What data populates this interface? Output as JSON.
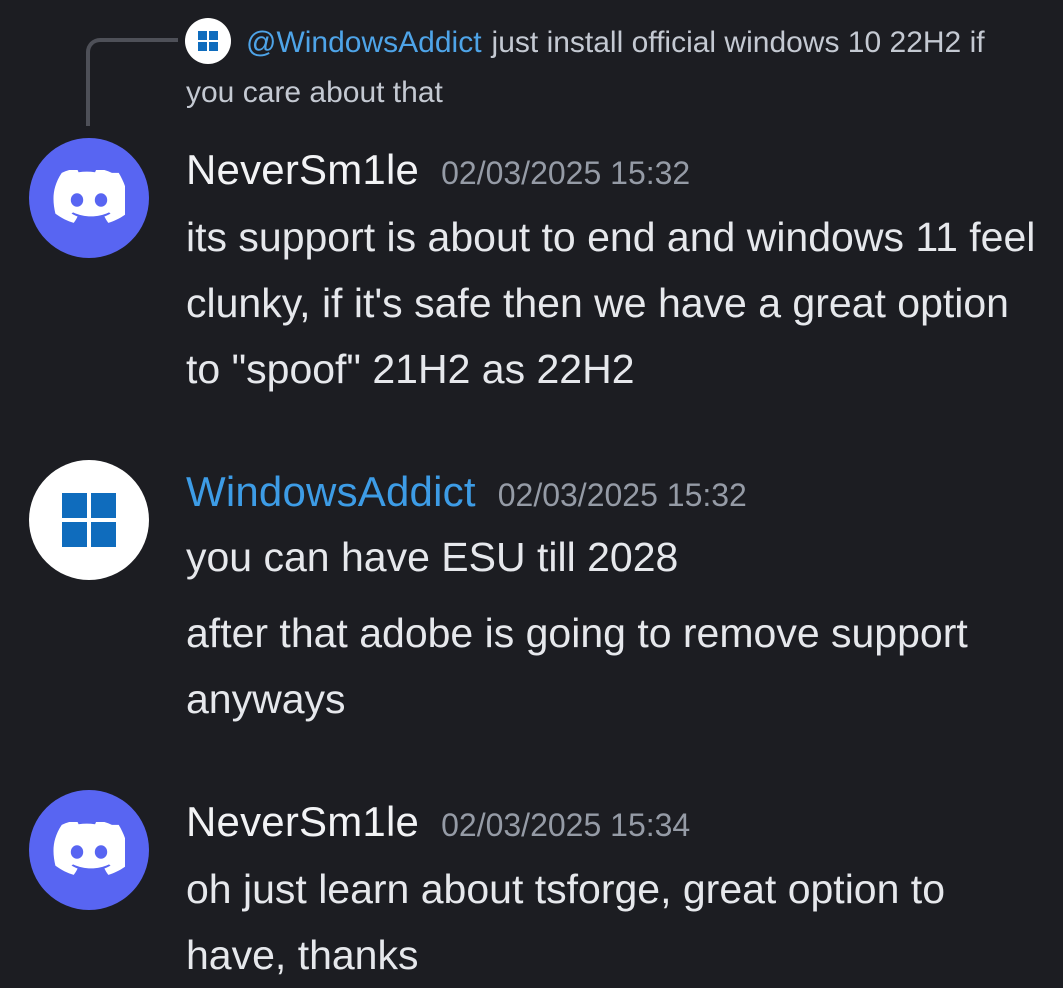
{
  "reply": {
    "mention": "@WindowsAddict",
    "text": "just install official windows 10 22H2 if you care about that"
  },
  "messages": [
    {
      "author": "NeverSm1le",
      "timestamp": "02/03/2025 15:32",
      "avatar_icon": "discord-logo-icon",
      "lines": [
        "its support is about to end and windows 11 feel clunky, if it's safe then we have a great option to \"spoof\" 21H2 as 22H2"
      ]
    },
    {
      "author": "WindowsAddict",
      "timestamp": "02/03/2025 15:32",
      "avatar_icon": "windows-logo-icon",
      "lines": [
        "you can have ESU till 2028",
        "after that adobe is going to remove support anyways"
      ]
    },
    {
      "author": "NeverSm1le",
      "timestamp": "02/03/2025 15:34",
      "avatar_icon": "discord-logo-icon",
      "lines": [
        "oh just learn about tsforge, great option to have, thanks"
      ]
    }
  ],
  "colors": {
    "background": "#1c1d22",
    "discord_blurple": "#5865f2",
    "mention_blue": "#4ea4e8",
    "windows_blue": "#0f6cbd",
    "timestamp_gray": "#959ba6"
  }
}
